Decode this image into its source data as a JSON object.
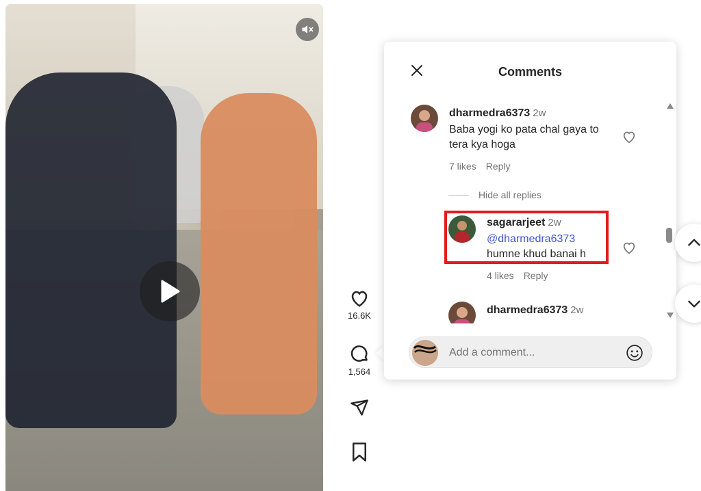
{
  "video": {
    "mute_icon": "speaker-muted-icon",
    "play_icon": "play-icon"
  },
  "actions": {
    "likes_count": "16.6K",
    "comments_count": "1,564"
  },
  "comments_panel": {
    "title": "Comments",
    "comments": [
      {
        "username": "dharmedra6373",
        "time": "2w",
        "text": "Baba yogi ko pata chal gaya to tera kya hoga",
        "likes": "7 likes",
        "reply_label": "Reply"
      }
    ],
    "hide_replies_label": "Hide all replies",
    "reply": {
      "username": "sagararjeet",
      "time": "2w",
      "mention": "@dharmedra6373",
      "text": "humne khud banai h",
      "likes": "4 likes",
      "reply_label": "Reply"
    },
    "partial_comment": {
      "username": "dharmedra6373",
      "time": "2w"
    },
    "add_comment_placeholder": "Add a comment...",
    "highlight_color": "#e21b1b",
    "mention_color": "#3f51d8"
  }
}
